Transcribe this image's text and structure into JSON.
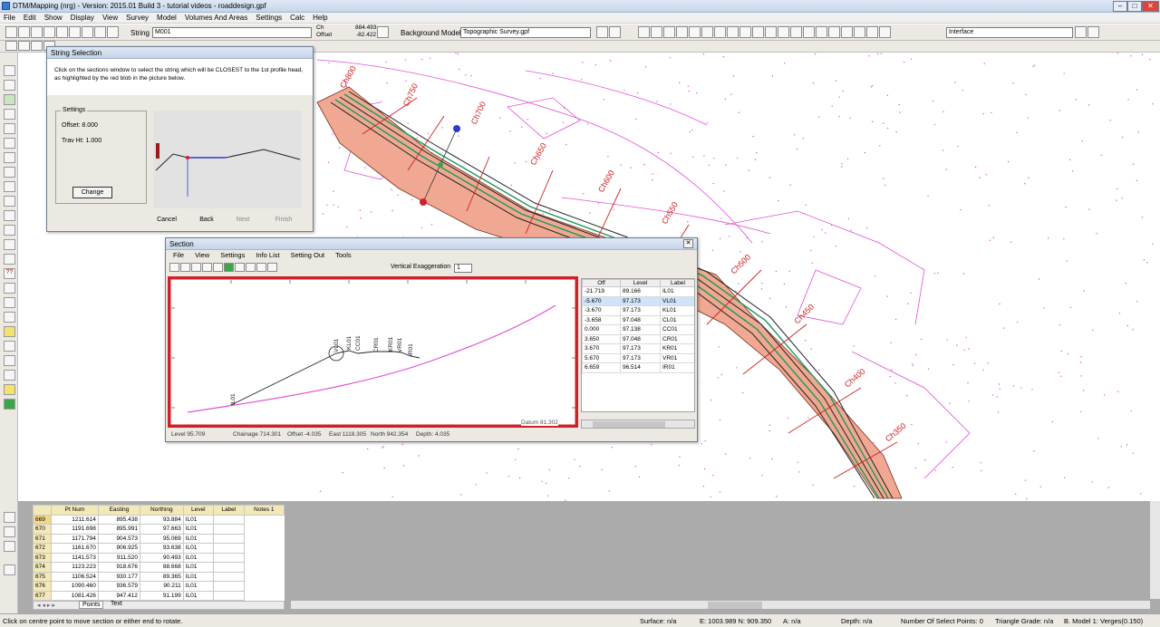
{
  "window": {
    "title": "DTM/Mapping (nrg) - Version: 2015.01 Build 3 - tutorial videos - roaddesign.gpf"
  },
  "menu": [
    "File",
    "Edit",
    "Show",
    "Display",
    "View",
    "Survey",
    "Model",
    "Volumes And Areas",
    "Settings",
    "Calc",
    "Help"
  ],
  "toolbar": {
    "string_label": "String",
    "string_value": "M001",
    "ch_label": "Ch",
    "offset_label": "Offset",
    "ch_value": "884.493",
    "offset_value": "-82.422",
    "bg_model_label": "Background Model:",
    "bg_model_value": "Topographic Survey.gpf",
    "interface_value": "Interface"
  },
  "string_selection": {
    "title": "String Selection",
    "instruction": "Click on the sections window to select the string which will be CLOSEST to the 1st profile head, as highlighted by the red blob in the picture below.",
    "settings_label": "Settings",
    "offset": "Offset: 8.000",
    "trav_ht": "Trav Ht: 1.000",
    "change_btn": "Change",
    "cancel_btn": "Cancel",
    "back_btn": "Back",
    "next_btn": "Next",
    "finish_btn": "Finish"
  },
  "section": {
    "title": "Section",
    "menu": [
      "File",
      "View",
      "Settings",
      "Info List",
      "Setting Out",
      "Tools"
    ],
    "vert_exag_label": "Vertical Exaggeration",
    "vert_exag_value": "1",
    "table_headers": [
      "Off",
      "Level",
      "Label"
    ],
    "rows": [
      [
        "-21.719",
        "89.166",
        "IL01"
      ],
      [
        "-5.670",
        "97.173",
        "VL01"
      ],
      [
        "-3.670",
        "97.173",
        "KL01"
      ],
      [
        "-3.658",
        "97.048",
        "CL01"
      ],
      [
        "0.000",
        "97.138",
        "CC01"
      ],
      [
        "3.650",
        "97.048",
        "CR01"
      ],
      [
        "3.670",
        "97.173",
        "KR01"
      ],
      [
        "5.670",
        "97.173",
        "VR01"
      ],
      [
        "6.659",
        "96.514",
        "IR01"
      ]
    ],
    "profile_labels": [
      "IL01",
      "VL01",
      "KL01",
      "CC01",
      "CR01",
      "KR01",
      "VR01",
      "IR01"
    ],
    "status": {
      "level": "Level 95.709",
      "chainage": "Chainage 714.301",
      "offset": "Offset -4.035",
      "east": "East 1118.305",
      "north": "North 942.354",
      "depth": "Depth: 4.035",
      "right": "Datum 81.302"
    }
  },
  "map": {
    "chainages": [
      "Ch800",
      "Ch750",
      "Ch700",
      "Ch650",
      "Ch600",
      "Ch550",
      "Ch500",
      "Ch450",
      "Ch400",
      "Ch350"
    ]
  },
  "points_table": {
    "headers": [
      "Pt Num",
      "Easting",
      "Northing",
      "Level",
      "Label",
      "Notes 1"
    ],
    "rows": [
      [
        "669",
        "1211.614",
        "895.438",
        "93.884",
        "IL01",
        ""
      ],
      [
        "670",
        "1191.698",
        "895.991",
        "97.663",
        "IL01",
        ""
      ],
      [
        "671",
        "1171.794",
        "904.573",
        "95.069",
        "IL01",
        ""
      ],
      [
        "672",
        "1161.670",
        "906.925",
        "93.638",
        "IL01",
        ""
      ],
      [
        "673",
        "1141.573",
        "911.520",
        "90.493",
        "IL01",
        ""
      ],
      [
        "674",
        "1123.223",
        "918.676",
        "88.668",
        "IL01",
        ""
      ],
      [
        "675",
        "1106.524",
        "930.177",
        "89.365",
        "IL01",
        ""
      ],
      [
        "676",
        "1090.460",
        "936.579",
        "90.211",
        "IL01",
        ""
      ],
      [
        "677",
        "1081.426",
        "947.412",
        "91.199",
        "IL01",
        ""
      ]
    ],
    "tabs": [
      "Points",
      "Text"
    ]
  },
  "statusbar": {
    "hint": "Click on centre point to move section or either end to rotate.",
    "surface": "Surface: n/a",
    "coords": "E: 1003.989  N: 909.350",
    "a": "A: n/a",
    "depth": "Depth: n/a",
    "select_points": "Number Of Select Points: 0",
    "tri_grade": "Triangle Grade: n/a",
    "model": "B. Model 1: Verges(0.150)"
  },
  "colors": {
    "road_fill": "#f0a892",
    "magenta": "#e050d8",
    "highlight": "#d0202a",
    "chainage_red": "#d02020"
  }
}
